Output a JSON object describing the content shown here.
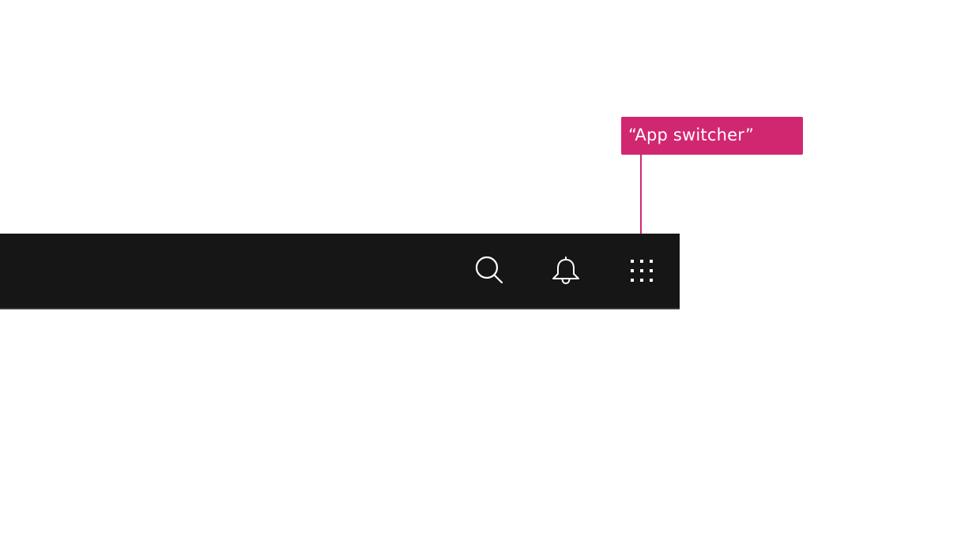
{
  "callout": {
    "label": "“App switcher”",
    "color": "#d12771"
  },
  "header": {
    "background": "#161616",
    "actions": [
      {
        "icon": "search-icon"
      },
      {
        "icon": "bell-icon"
      },
      {
        "icon": "grid-icon"
      }
    ]
  }
}
